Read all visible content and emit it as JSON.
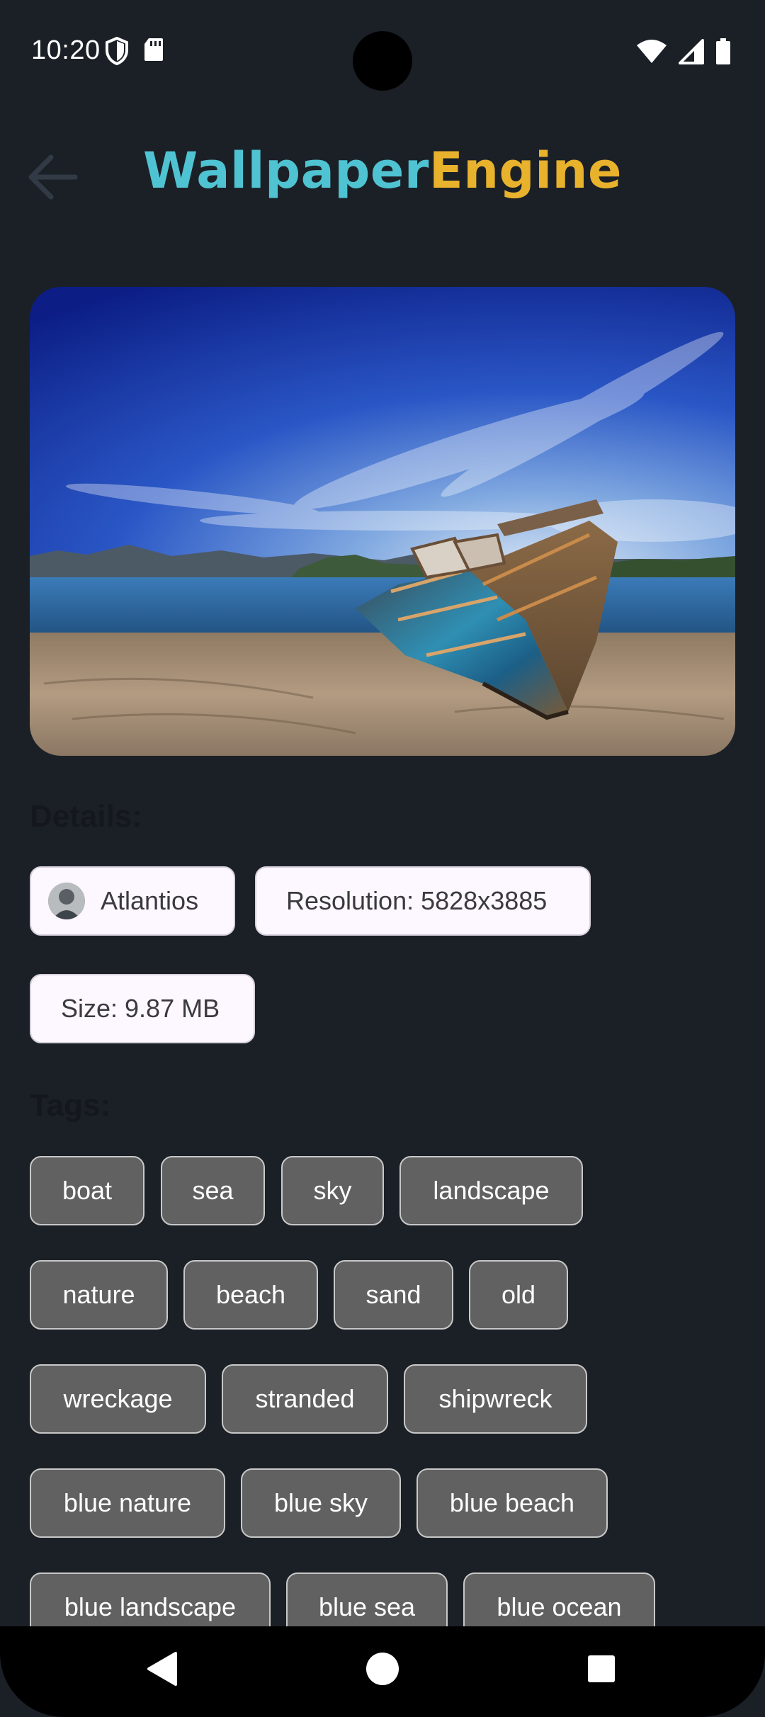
{
  "status_bar": {
    "time": "10:20",
    "left_icons": [
      "shield-icon",
      "sd-card-icon"
    ],
    "right_icons": [
      "wifi-icon",
      "cell-signal-icon",
      "battery-icon"
    ]
  },
  "app_bar": {
    "title_part_1": "Wallpaper",
    "title_part_2": "Engine",
    "title_colors": [
      "#4fc3d2",
      "#e8b22d"
    ],
    "back_icon": "arrow-back-icon"
  },
  "wallpaper": {
    "description": "Wallpaper preview image"
  },
  "details": {
    "heading": "Details:",
    "author": "Atlantios",
    "resolution": "Resolution: 5828x3885",
    "size": "Size: 9.87 MB"
  },
  "tags": {
    "heading": "Tags:",
    "items": [
      "boat",
      "sea",
      "sky",
      "landscape",
      "nature",
      "beach",
      "sand",
      "old",
      "wreckage",
      "stranded",
      "shipwreck",
      "blue nature",
      "blue sky",
      "blue beach",
      "blue landscape",
      "blue sea",
      "blue ocean"
    ]
  },
  "nav_bar": {
    "icons": [
      "back-triangle-icon",
      "home-circle-icon",
      "recents-square-icon"
    ]
  },
  "colors": {
    "background": "#1b2027",
    "chip_light": "#fdf7ff",
    "tag_bg": "#616161"
  }
}
